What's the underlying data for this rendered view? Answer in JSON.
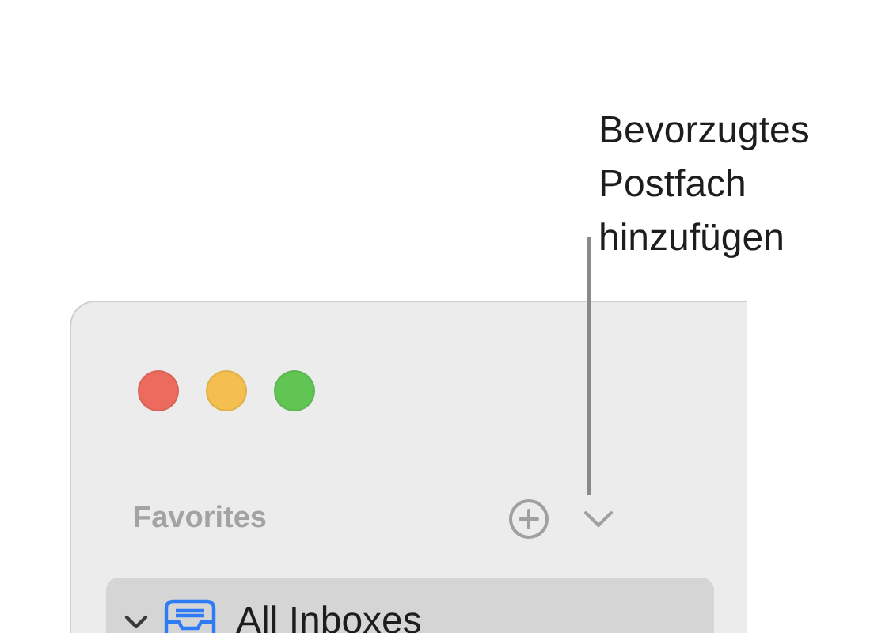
{
  "annotation": {
    "text": "Bevorzugtes Postfach hinzufügen"
  },
  "sidebar": {
    "section": {
      "label": "Favorites"
    },
    "items": [
      {
        "label": "All Inboxes",
        "selected": true,
        "expanded": true
      }
    ]
  }
}
